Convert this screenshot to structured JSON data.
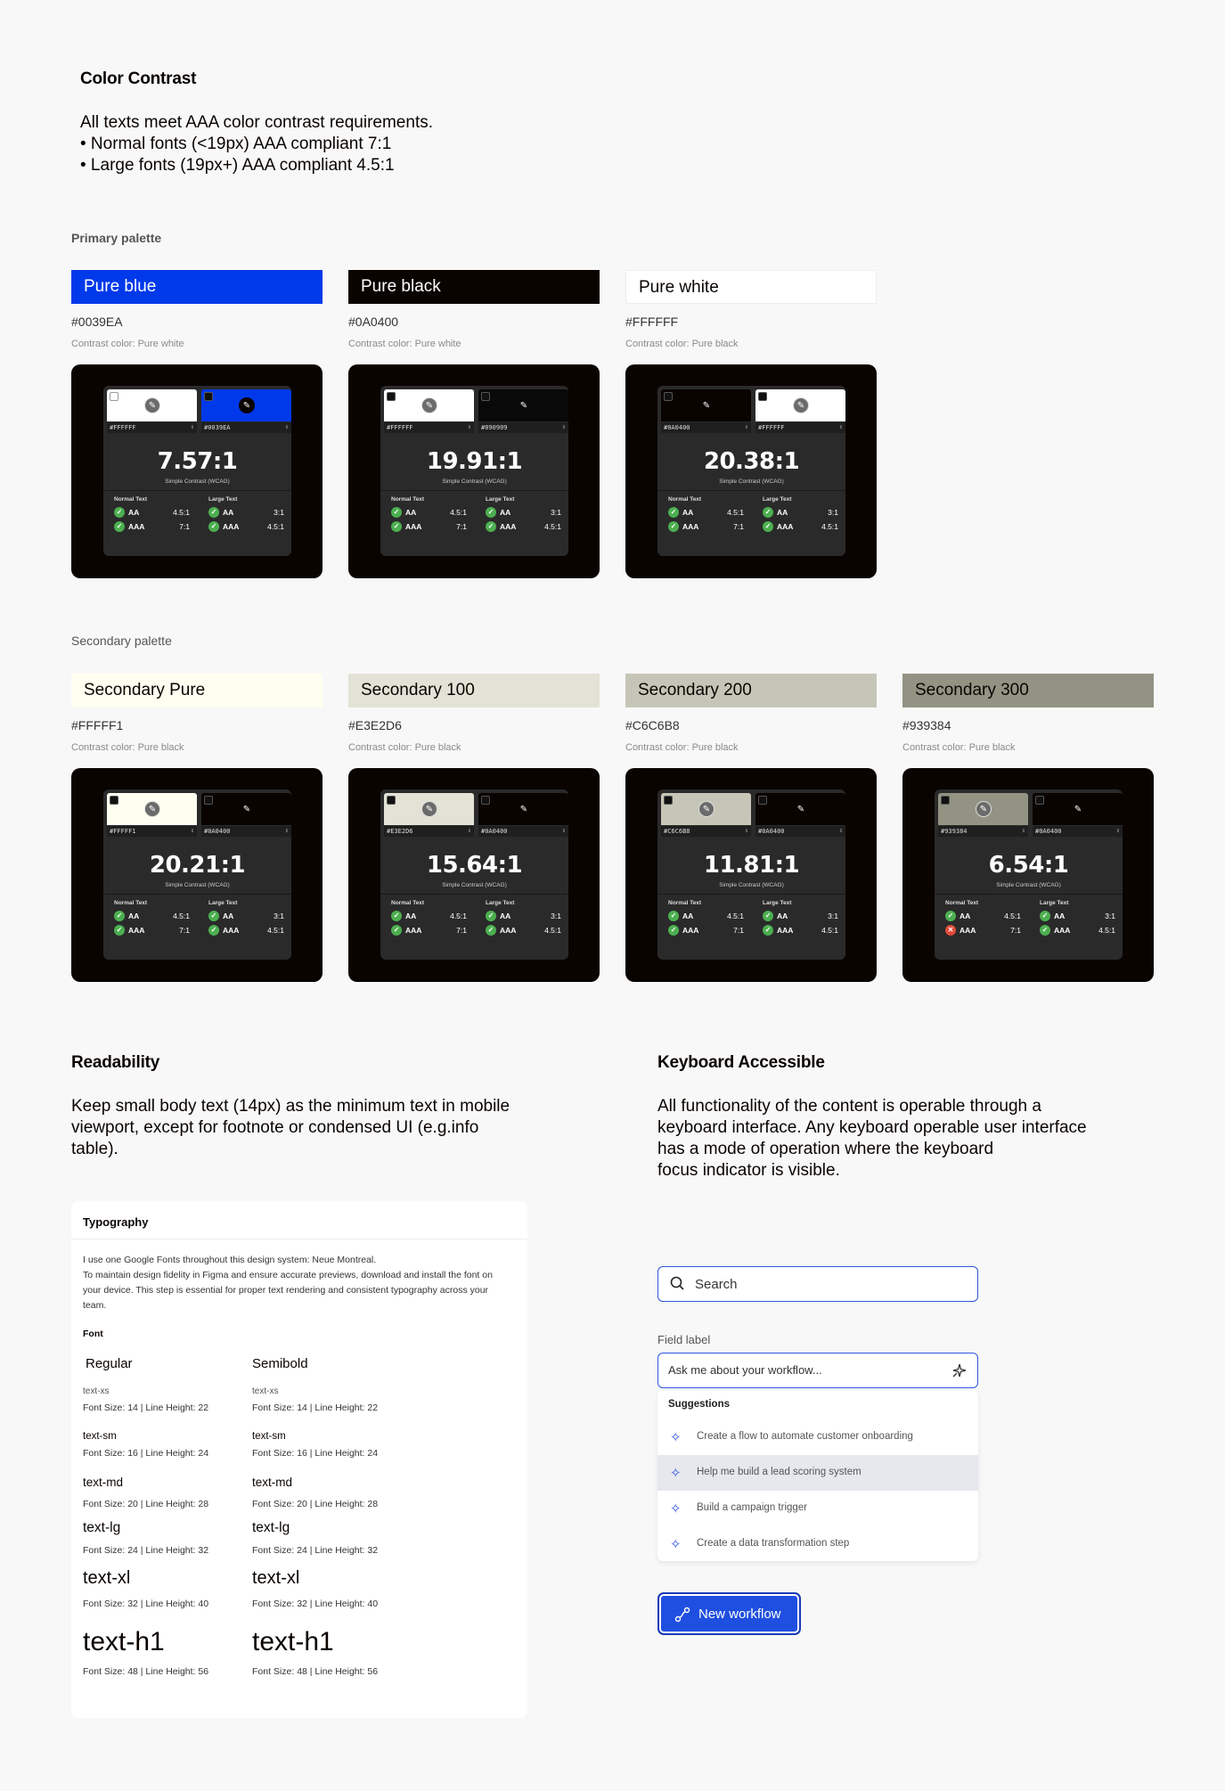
{
  "color_contrast": {
    "title": "Color Contrast",
    "lines": [
      "All texts meet AAA color contrast requirements.",
      "• Normal fonts (<19px) AAA compliant 7:1",
      "• Large fonts (19px+) AAA compliant 4.5:1"
    ]
  },
  "primary": {
    "title": "Primary palette",
    "items": [
      {
        "name": "Pure blue",
        "hex": "#0039EA",
        "note": "Contrast color: Pure white",
        "bg": "#0039EA",
        "fg": "#FFFFFF",
        "fg_hex": "#FFFFFF",
        "bg_hex": "#0039EA",
        "ratio": "7.57:1"
      },
      {
        "name": "Pure black",
        "hex": "#0A0400",
        "note": "Contrast color: Pure white",
        "bg": "#0A0400",
        "fg": "#FFFFFF",
        "fg_hex": "#FFFFFF",
        "bg_hex": "#090909",
        "ratio": "19.91:1"
      },
      {
        "name": "Pure white",
        "hex": "#FFFFFF",
        "note": "Contrast color: Pure black",
        "bg": "#FFFFFF",
        "fg": "#0A0400",
        "fg_hex": "#0A0400",
        "bg_hex": "#FFFFFF",
        "ratio": "20.38:1"
      }
    ]
  },
  "secondary": {
    "title": "Secondary palette",
    "items": [
      {
        "name": "Secondary Pure",
        "hex": "#FFFFF1",
        "note": "Contrast color: Pure black",
        "bg": "#FFFFF1",
        "fg": "#0A0400",
        "fg_hex": "#FFFFF1",
        "bg_hex": "#0A0400",
        "ratio": "20.21:1"
      },
      {
        "name": "Secondary 100",
        "hex": "#E3E2D6",
        "note": "Contrast color: Pure black",
        "bg": "#E3E2D6",
        "fg": "#0A0400",
        "fg_hex": "#E3E2D6",
        "bg_hex": "#0A0400",
        "ratio": "15.64:1"
      },
      {
        "name": "Secondary 200",
        "hex": "#C6C6B8",
        "note": "Contrast color: Pure black",
        "bg": "#C6C6B8",
        "fg": "#0A0400",
        "fg_hex": "#C6C6B8",
        "bg_hex": "#0A0400",
        "ratio": "11.81:1"
      },
      {
        "name": "Secondary 300",
        "hex": "#939384",
        "note": "Contrast color: Pure black",
        "bg": "#939384",
        "fg": "#0A0400",
        "fg_hex": "#939384",
        "bg_hex": "#0A0400",
        "ratio": "6.54:1"
      }
    ]
  },
  "checker": {
    "subtitle": "Simple Contrast (WCAG)",
    "normal_text": "Normal Text",
    "large_text": "Large Text",
    "aa": "AA",
    "aaa": "AAA",
    "normal_aa": "4.5:1",
    "normal_aaa": "7:1",
    "large_aa": "3:1",
    "large_aaa": "4.5:1"
  },
  "readability": {
    "title": "Readability",
    "lines": [
      "Keep small body text (14px) as the minimum text in mobile",
      "viewport, except for footnote or condensed UI (e.g.info",
      "table)."
    ]
  },
  "keyboard": {
    "title": "Keyboard Accessible",
    "lines": [
      "All functionality of the content is operable through a",
      "keyboard interface. Any keyboard operable user interface",
      "has a mode of operation where the keyboard",
      "focus indicator is visible."
    ]
  },
  "typography": {
    "title": "Typography",
    "intro": [
      "I use one Google Fonts throughout this design system: Neue Montreal.",
      "To maintain design fidelity in Figma and ensure accurate previews, download and install the font on",
      "your device. This step is essential for proper text rendering and consistent typography across your",
      "team."
    ],
    "font_label": "Font",
    "regular": "Regular",
    "semibold": "Semibold",
    "styles": [
      {
        "name": "text-xs",
        "spec": "Font Size: 14 | Line Height: 22"
      },
      {
        "name": "text-sm",
        "spec": "Font Size: 16 | Line Height: 24"
      },
      {
        "name": "text-md",
        "spec": "Font Size: 20 | Line Height: 28"
      },
      {
        "name": "text-lg",
        "spec": "Font Size: 24 | Line Height: 32"
      },
      {
        "name": "text-xl",
        "spec": "Font Size: 32 | Line Height: 40"
      },
      {
        "name": "text-h1",
        "spec": "Font Size: 48 | Line Height: 56"
      }
    ]
  },
  "search": {
    "placeholder": "Search"
  },
  "field": {
    "label": "Field label",
    "value": "Ask me about your workflow...",
    "suggestions_title": "Suggestions",
    "suggestions": [
      "Create a flow to automate customer onboarding",
      "Help me build a lead scoring system",
      "Build a campaign trigger",
      "Create a data transformation step"
    ]
  },
  "new_workflow": {
    "label": "New workflow"
  }
}
